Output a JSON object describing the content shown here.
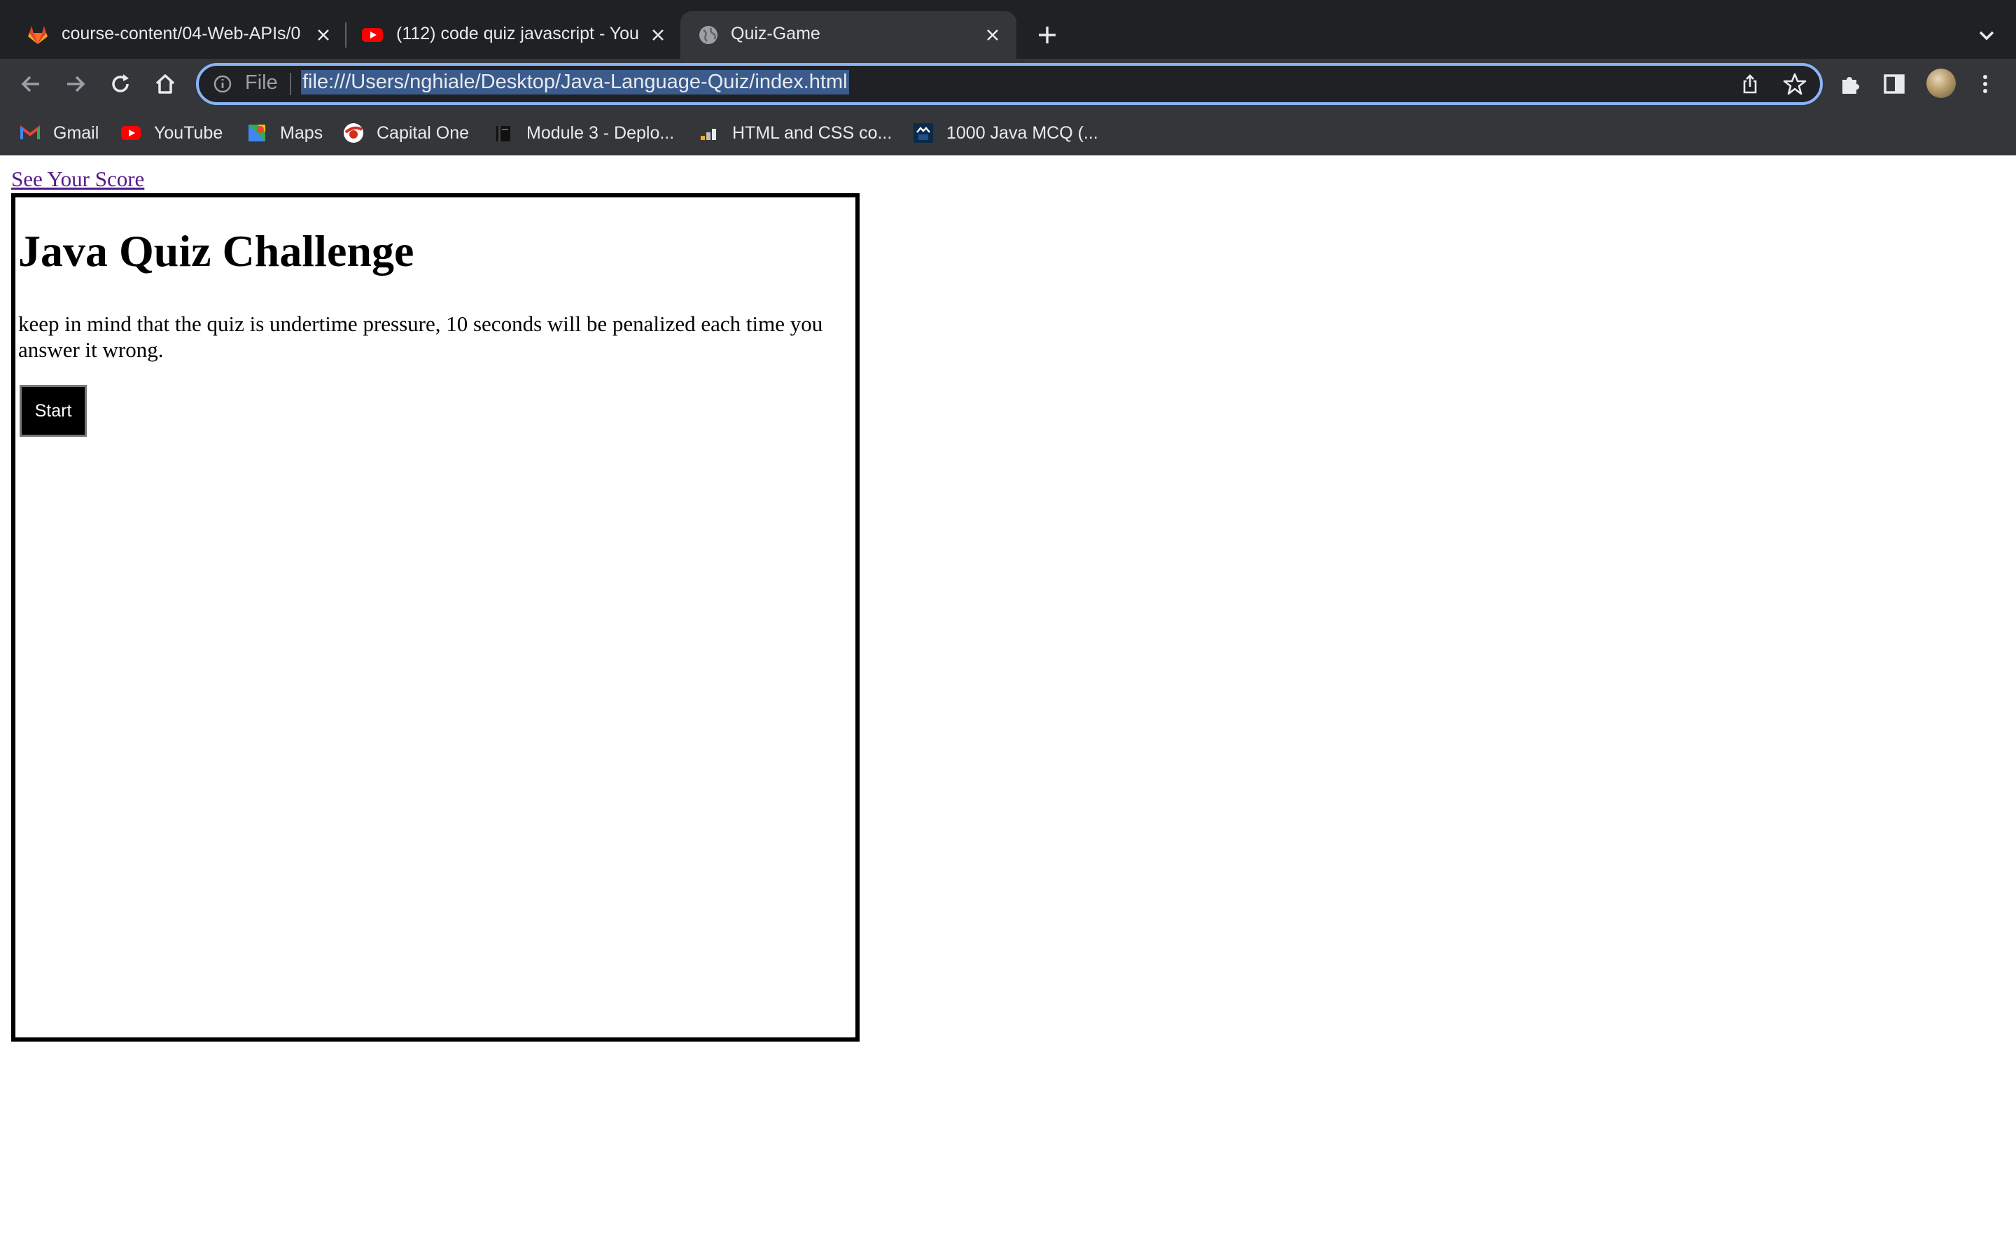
{
  "browser": {
    "tabs": [
      {
        "title": "course-content/04-Web-APIs/0",
        "icon": "gitlab-icon",
        "active": false
      },
      {
        "title": "(112) code quiz javascript - You",
        "icon": "youtube-icon",
        "active": false
      },
      {
        "title": "Quiz-Game",
        "icon": "globe-icon",
        "active": true
      }
    ],
    "omnibox": {
      "scheme_label": "File",
      "url": "file:///Users/nghiale/Desktop/Java-Language-Quiz/index.html"
    },
    "bookmarks": [
      {
        "label": "Gmail",
        "icon": "gmail-icon"
      },
      {
        "label": "YouTube",
        "icon": "youtube-icon"
      },
      {
        "label": "Maps",
        "icon": "maps-icon"
      },
      {
        "label": "Capital One",
        "icon": "capital-one-icon"
      },
      {
        "label": "Module 3 - Deplo...",
        "icon": "book-icon"
      },
      {
        "label": "HTML and CSS co...",
        "icon": "chart-icon"
      },
      {
        "label": "1000 Java MCQ (...",
        "icon": "sf-icon"
      }
    ],
    "colors": {
      "accent": "#8ab4f8",
      "frame": "#202124",
      "toolbar": "#35363a"
    }
  },
  "page": {
    "score_link": "See Your Score",
    "title": "Java Quiz Challenge",
    "description": "keep in mind that the quiz is undertime pressure, 10 seconds will be penalized each time you answer it wrong.",
    "start_button": "Start"
  }
}
